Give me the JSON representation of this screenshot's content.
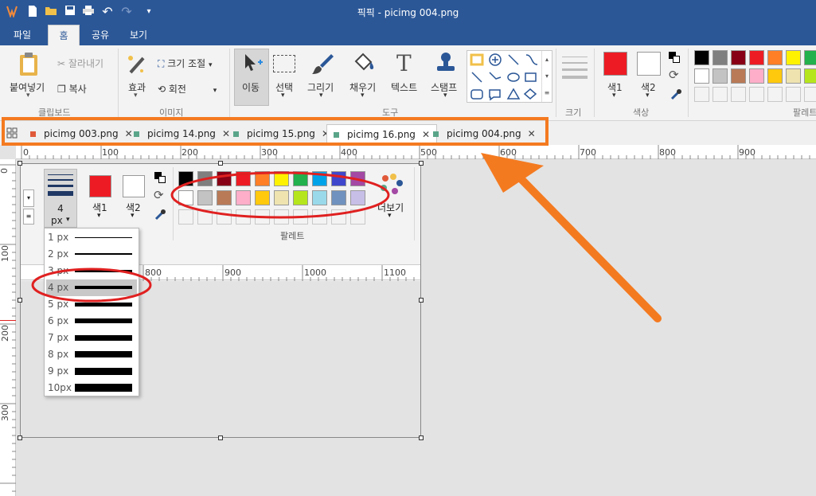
{
  "titlebar": {
    "title": "픽픽 - picimg 004.png"
  },
  "menu": {
    "tabs": [
      "파일",
      "홈",
      "공유",
      "보기"
    ]
  },
  "ribbon": {
    "clipboard": {
      "paste": "붙여넣기",
      "cut": "잘라내기",
      "copy": "복사",
      "group": "클립보드"
    },
    "image": {
      "effect": "효과",
      "resize": "크기 조절",
      "rotate": "회전",
      "group": "이미지"
    },
    "tools": {
      "move": "이동",
      "select": "선택",
      "draw": "그리기",
      "fill": "채우기",
      "text": "텍스트",
      "stamp": "스탬프",
      "group": "도구"
    },
    "size": {
      "group": "크기"
    },
    "color": {
      "color1": "색1",
      "color2": "색2",
      "group": "색상"
    },
    "palette": {
      "group": "팔레트"
    }
  },
  "doctabs": [
    {
      "label": "picimg 003.png",
      "color": "#e05a3a",
      "active": false
    },
    {
      "label": "picimg 14.png",
      "color": "#5aa58a",
      "active": false
    },
    {
      "label": "picimg 15.png",
      "color": "#5aa58a",
      "active": false
    },
    {
      "label": "picimg 16.png",
      "color": "#5aa58a",
      "active": true
    },
    {
      "label": "picimg 004.png",
      "color": "#5aa58a",
      "active": false
    }
  ],
  "hruler": [
    "0",
    "100",
    "200",
    "300",
    "400",
    "500",
    "600",
    "700",
    "800",
    "900"
  ],
  "vruler": [
    "0",
    "100",
    "200",
    "300"
  ],
  "inner": {
    "size_value": "4",
    "size_unit": "px",
    "color1": "색1",
    "color2": "색2",
    "palette_group": "팔레트",
    "more": "더보기",
    "ruler": [
      "800",
      "900",
      "1000",
      "1100"
    ]
  },
  "size_options": [
    "1 px",
    "2 px",
    "3 px",
    "4 px",
    "5 px",
    "6 px",
    "7 px",
    "8 px",
    "9 px",
    "10px"
  ],
  "palette_colors": {
    "row1": [
      "#000000",
      "#7f7f7f",
      "#880015",
      "#ed1c24",
      "#ff7f27",
      "#fff200",
      "#22b14c",
      "#00a2e8",
      "#3f48cc",
      "#a349a4"
    ],
    "row2": [
      "#ffffff",
      "#c3c3c3",
      "#b97a57",
      "#ffaec9",
      "#ffc90e",
      "#efe4b0",
      "#b5e61d",
      "#99d9ea",
      "#7092be",
      "#c8bfe7"
    ]
  },
  "accent": {
    "ribbon_blue": "#2b5797",
    "annotation_orange": "#f47a20",
    "annotation_red": "#e02020"
  }
}
